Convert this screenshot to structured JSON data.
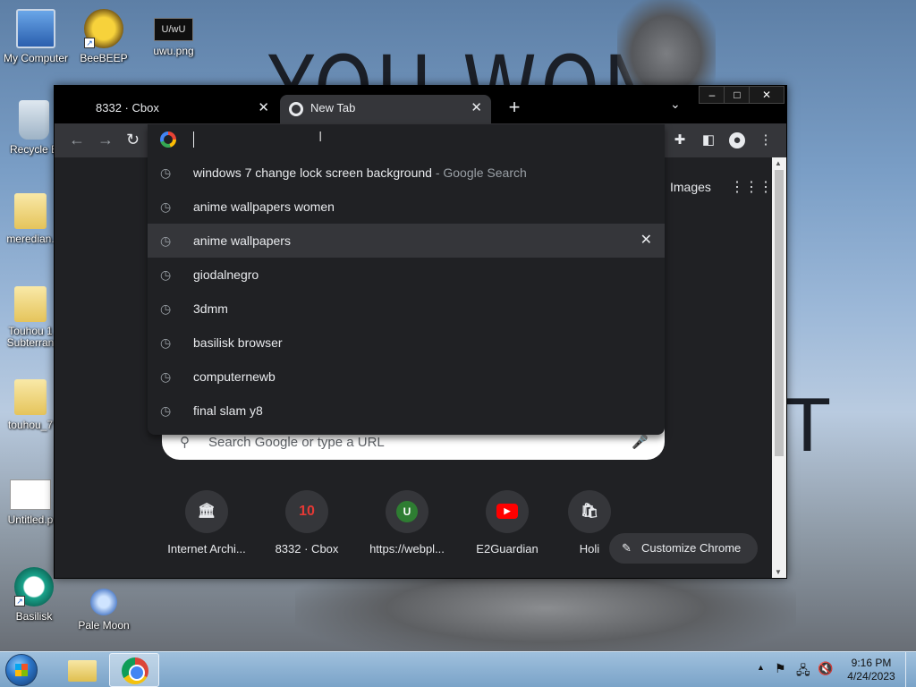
{
  "wallpaper": {
    "headline": "YOU WON",
    "fragment": "T"
  },
  "desktop_icons": [
    {
      "label": "My Computer",
      "icon": "computer-icon"
    },
    {
      "label": "BeeBEEP",
      "icon": "bee-icon"
    },
    {
      "label": "uwu.png",
      "icon": "image-file-icon",
      "thumb_text": "U/wU"
    },
    {
      "label": "Recycle B",
      "icon": "recycle-bin-icon"
    },
    {
      "label": "meredian.",
      "icon": "folder-icon"
    },
    {
      "label": "Touhou 1 Subterran",
      "icon": "folder-icon"
    },
    {
      "label": "touhou_7",
      "icon": "folder-icon"
    },
    {
      "label": "Untitled.p",
      "icon": "image-file-icon"
    },
    {
      "label": "Basilisk",
      "icon": "basilisk-icon"
    },
    {
      "label": "Pale Moon",
      "icon": "pale-moon-icon"
    }
  ],
  "browser": {
    "tabs": [
      {
        "title": "8332 · Cbox",
        "active": false
      },
      {
        "title": "New Tab",
        "active": true
      }
    ],
    "new_tab_symbol": "+",
    "tab_list_symbol": "⌄",
    "window_controls": {
      "minimize": "–",
      "maximize": "□",
      "close": "✕"
    },
    "omnibox": {
      "value": "",
      "suggestions": [
        {
          "text": "windows 7 change lock screen background",
          "suffix": " - Google Search",
          "hover": false
        },
        {
          "text": "anime wallpapers women",
          "suffix": "",
          "hover": false
        },
        {
          "text": "anime wallpapers",
          "suffix": "",
          "hover": true
        },
        {
          "text": "giodalnegro",
          "suffix": "",
          "hover": false
        },
        {
          "text": "3dmm",
          "suffix": "",
          "hover": false
        },
        {
          "text": "basilisk browser",
          "suffix": "",
          "hover": false
        },
        {
          "text": "computernewb",
          "suffix": "",
          "hover": false
        },
        {
          "text": "final slam y8",
          "suffix": "",
          "hover": false
        }
      ]
    },
    "ntp": {
      "images_link": "Images",
      "search_placeholder": "Search Google or type a URL",
      "shortcuts": [
        {
          "label": "Internet Archi...",
          "glyph": "🏛",
          "color": "#e8eaed"
        },
        {
          "label": "8332 · Cbox",
          "glyph": "10",
          "color": "#e53935"
        },
        {
          "label": "https://webpl...",
          "glyph": "U",
          "color": "#ffffff"
        },
        {
          "label": "E2Guardian",
          "glyph": "▶",
          "color": "#ff0000"
        },
        {
          "label": "Holi",
          "glyph": "🛍",
          "color": "#e8eaed"
        }
      ],
      "customize_label": "Customize Chrome"
    }
  },
  "taskbar": {
    "time": "9:16 PM",
    "date": "4/24/2023",
    "tray_arrow": "▲"
  }
}
